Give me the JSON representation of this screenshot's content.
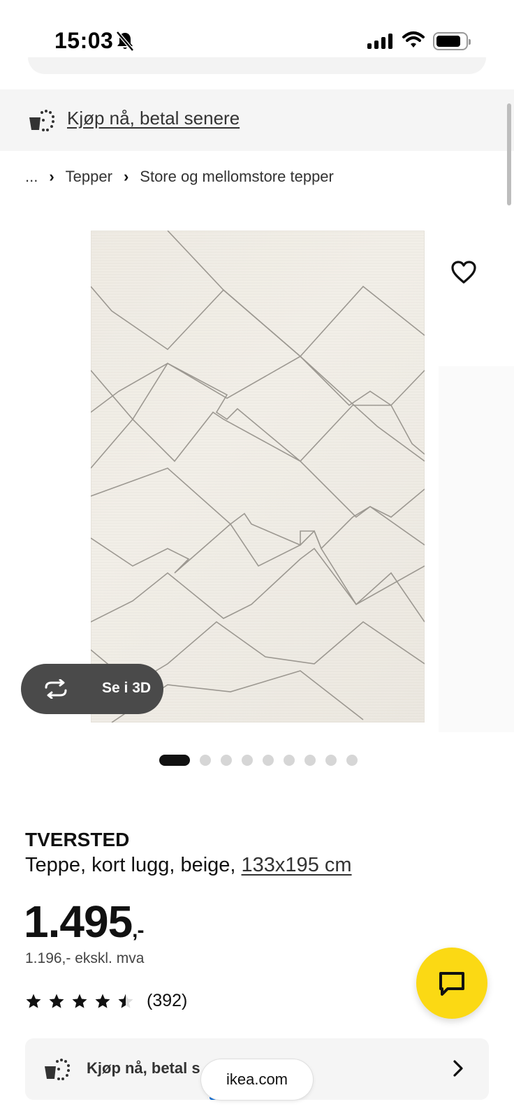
{
  "status_bar": {
    "time": "15:03",
    "silent_icon": "bell-slash-icon",
    "signal_icon": "cellular-signal-icon",
    "wifi_icon": "wifi-icon",
    "battery_icon": "battery-icon",
    "battery_level": 0.8
  },
  "banner": {
    "icon": "installment-cart-icon",
    "link": "Kjøp nå, betal senere"
  },
  "breadcrumb": {
    "items": [
      "...",
      "Tepper",
      "Store og mellomstore tepper"
    ],
    "separator_icon": "chevron-right-icon"
  },
  "gallery": {
    "favorite_icon": "heart-icon",
    "view_3d": {
      "icon": "rotate-3d-icon",
      "label": "Se i 3D"
    },
    "slide_count": 9,
    "active_slide": 1
  },
  "product": {
    "name": "TVERSTED",
    "description": "Teppe, kort lugg, beige, ",
    "size_link": "133x195 cm",
    "price": "1.495",
    "price_suffix": ",-",
    "price_ex_vat": "1.196,- ekskl. mva",
    "rating": 4.5,
    "rating_max": 5,
    "review_count": "(392)"
  },
  "bnpl_card": {
    "icon": "installment-cart-icon",
    "label": "Kjøp nå, betal s",
    "chevron": "chevron-right-icon"
  },
  "chat": {
    "icon": "chat-bubble-icon",
    "color": "#fbd914"
  },
  "browser": {
    "url": "ikea.com"
  },
  "colors": {
    "banner_bg": "#f5f5f5",
    "chat_yellow": "#fbd914",
    "button_3d_bg": "#4a4a4a"
  }
}
